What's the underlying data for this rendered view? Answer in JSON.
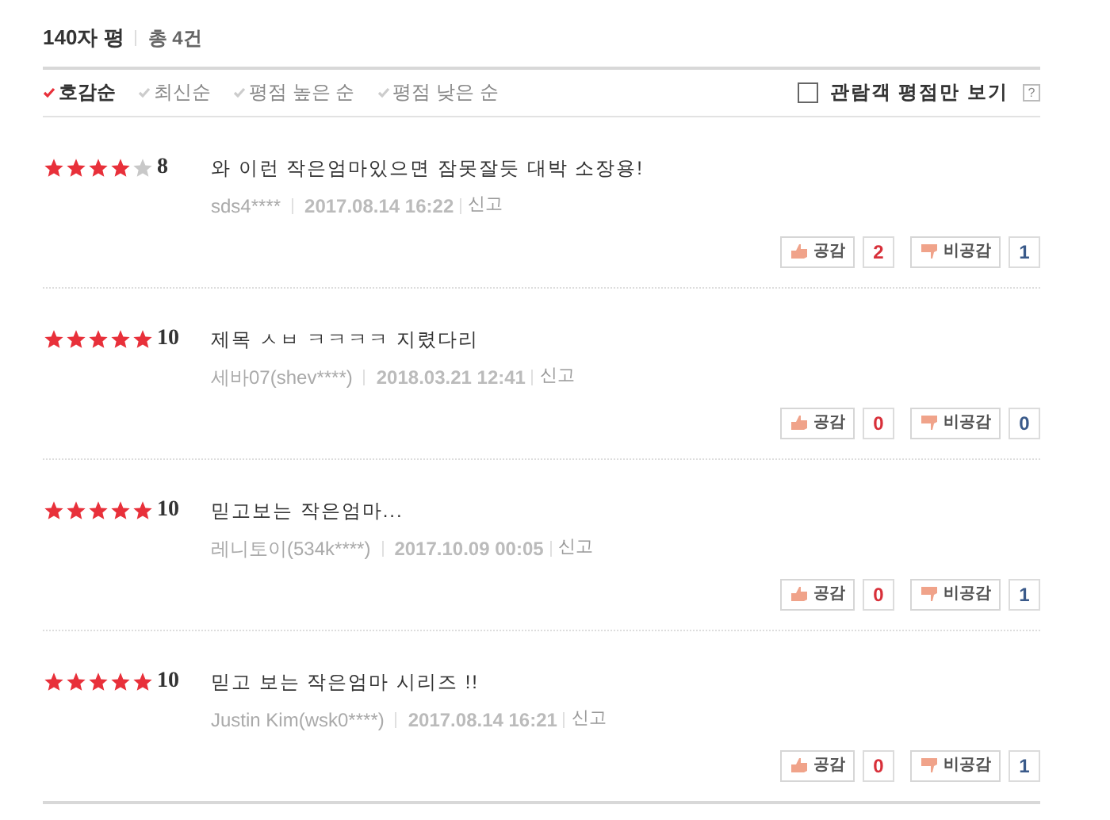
{
  "header": {
    "title": "140자 평",
    "total": "총 4건"
  },
  "sort_options": [
    {
      "label": "호감순",
      "selected": true
    },
    {
      "label": "최신순",
      "selected": false
    },
    {
      "label": "평점 높은 순",
      "selected": false
    },
    {
      "label": "평점 낮은 순",
      "selected": false
    }
  ],
  "audience_filter": {
    "label": "관람객 평점만 보기",
    "checked": false,
    "help": "?"
  },
  "reviews": [
    {
      "stars": 4,
      "score": "8",
      "text": "와 이런 작은엄마있으면 잠못잘듯 대박 소장용!",
      "user": "sds4****",
      "date": "2017.08.14 16:22",
      "report": "신고",
      "like_label": "공감",
      "like_count": "2",
      "dislike_label": "비공감",
      "dislike_count": "1"
    },
    {
      "stars": 5,
      "score": "10",
      "text": "제목 ㅅㅂ ㅋㅋㅋㅋ 지렸다리",
      "user": "세바07(shev****)",
      "date": "2018.03.21 12:41",
      "report": "신고",
      "like_label": "공감",
      "like_count": "0",
      "dislike_label": "비공감",
      "dislike_count": "0"
    },
    {
      "stars": 5,
      "score": "10",
      "text": "믿고보는 작은엄마...",
      "user": "레니토이(534k****)",
      "date": "2017.10.09 00:05",
      "report": "신고",
      "like_label": "공감",
      "like_count": "0",
      "dislike_label": "비공감",
      "dislike_count": "1"
    },
    {
      "stars": 5,
      "score": "10",
      "text": "믿고 보는 작은엄마 시리즈 !!",
      "user": "Justin Kim(wsk0****)",
      "date": "2017.08.14 16:21",
      "report": "신고",
      "like_label": "공감",
      "like_count": "0",
      "dislike_label": "비공감",
      "dislike_count": "1"
    }
  ]
}
